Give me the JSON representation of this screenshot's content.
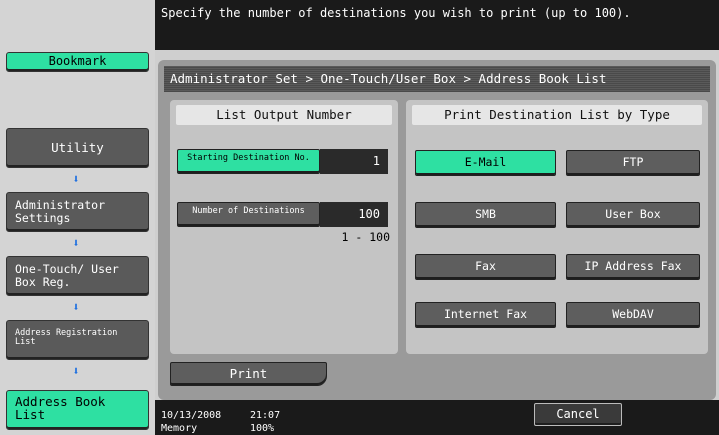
{
  "sidebar": {
    "bookmark": "Bookmark",
    "utility": "Utility",
    "admin_settings": "Administrator Settings",
    "one_touch": "One-Touch/ User Box Reg.",
    "address_reg": "Address Registration List",
    "address_book": "Address Book List"
  },
  "header": {
    "message": "Specify the number of destinations you wish to print (up to 100).",
    "breadcrumb": "Administrator Set > One-Touch/User Box > Address Book List"
  },
  "list_output": {
    "title": "List Output Number",
    "starting_label": "Starting Destination No.",
    "starting_value": "1",
    "number_label": "Number of Destinations",
    "number_value": "100",
    "range": "1  -  100"
  },
  "print_by_type": {
    "title": "Print Destination List by Type",
    "types": [
      "E-Mail",
      "FTP",
      "SMB",
      "User Box",
      "Fax",
      "IP Address Fax",
      "Internet Fax",
      "WebDAV"
    ]
  },
  "print_label": "Print",
  "status": {
    "date": "10/13/2008",
    "time": "21:07",
    "memory_label": "Memory",
    "memory_value": "100%"
  },
  "cancel_label": "Cancel",
  "colors": {
    "accent": "#2ee0a2",
    "bar": "#1a1a1a",
    "arrow": "#1d6fe0"
  }
}
